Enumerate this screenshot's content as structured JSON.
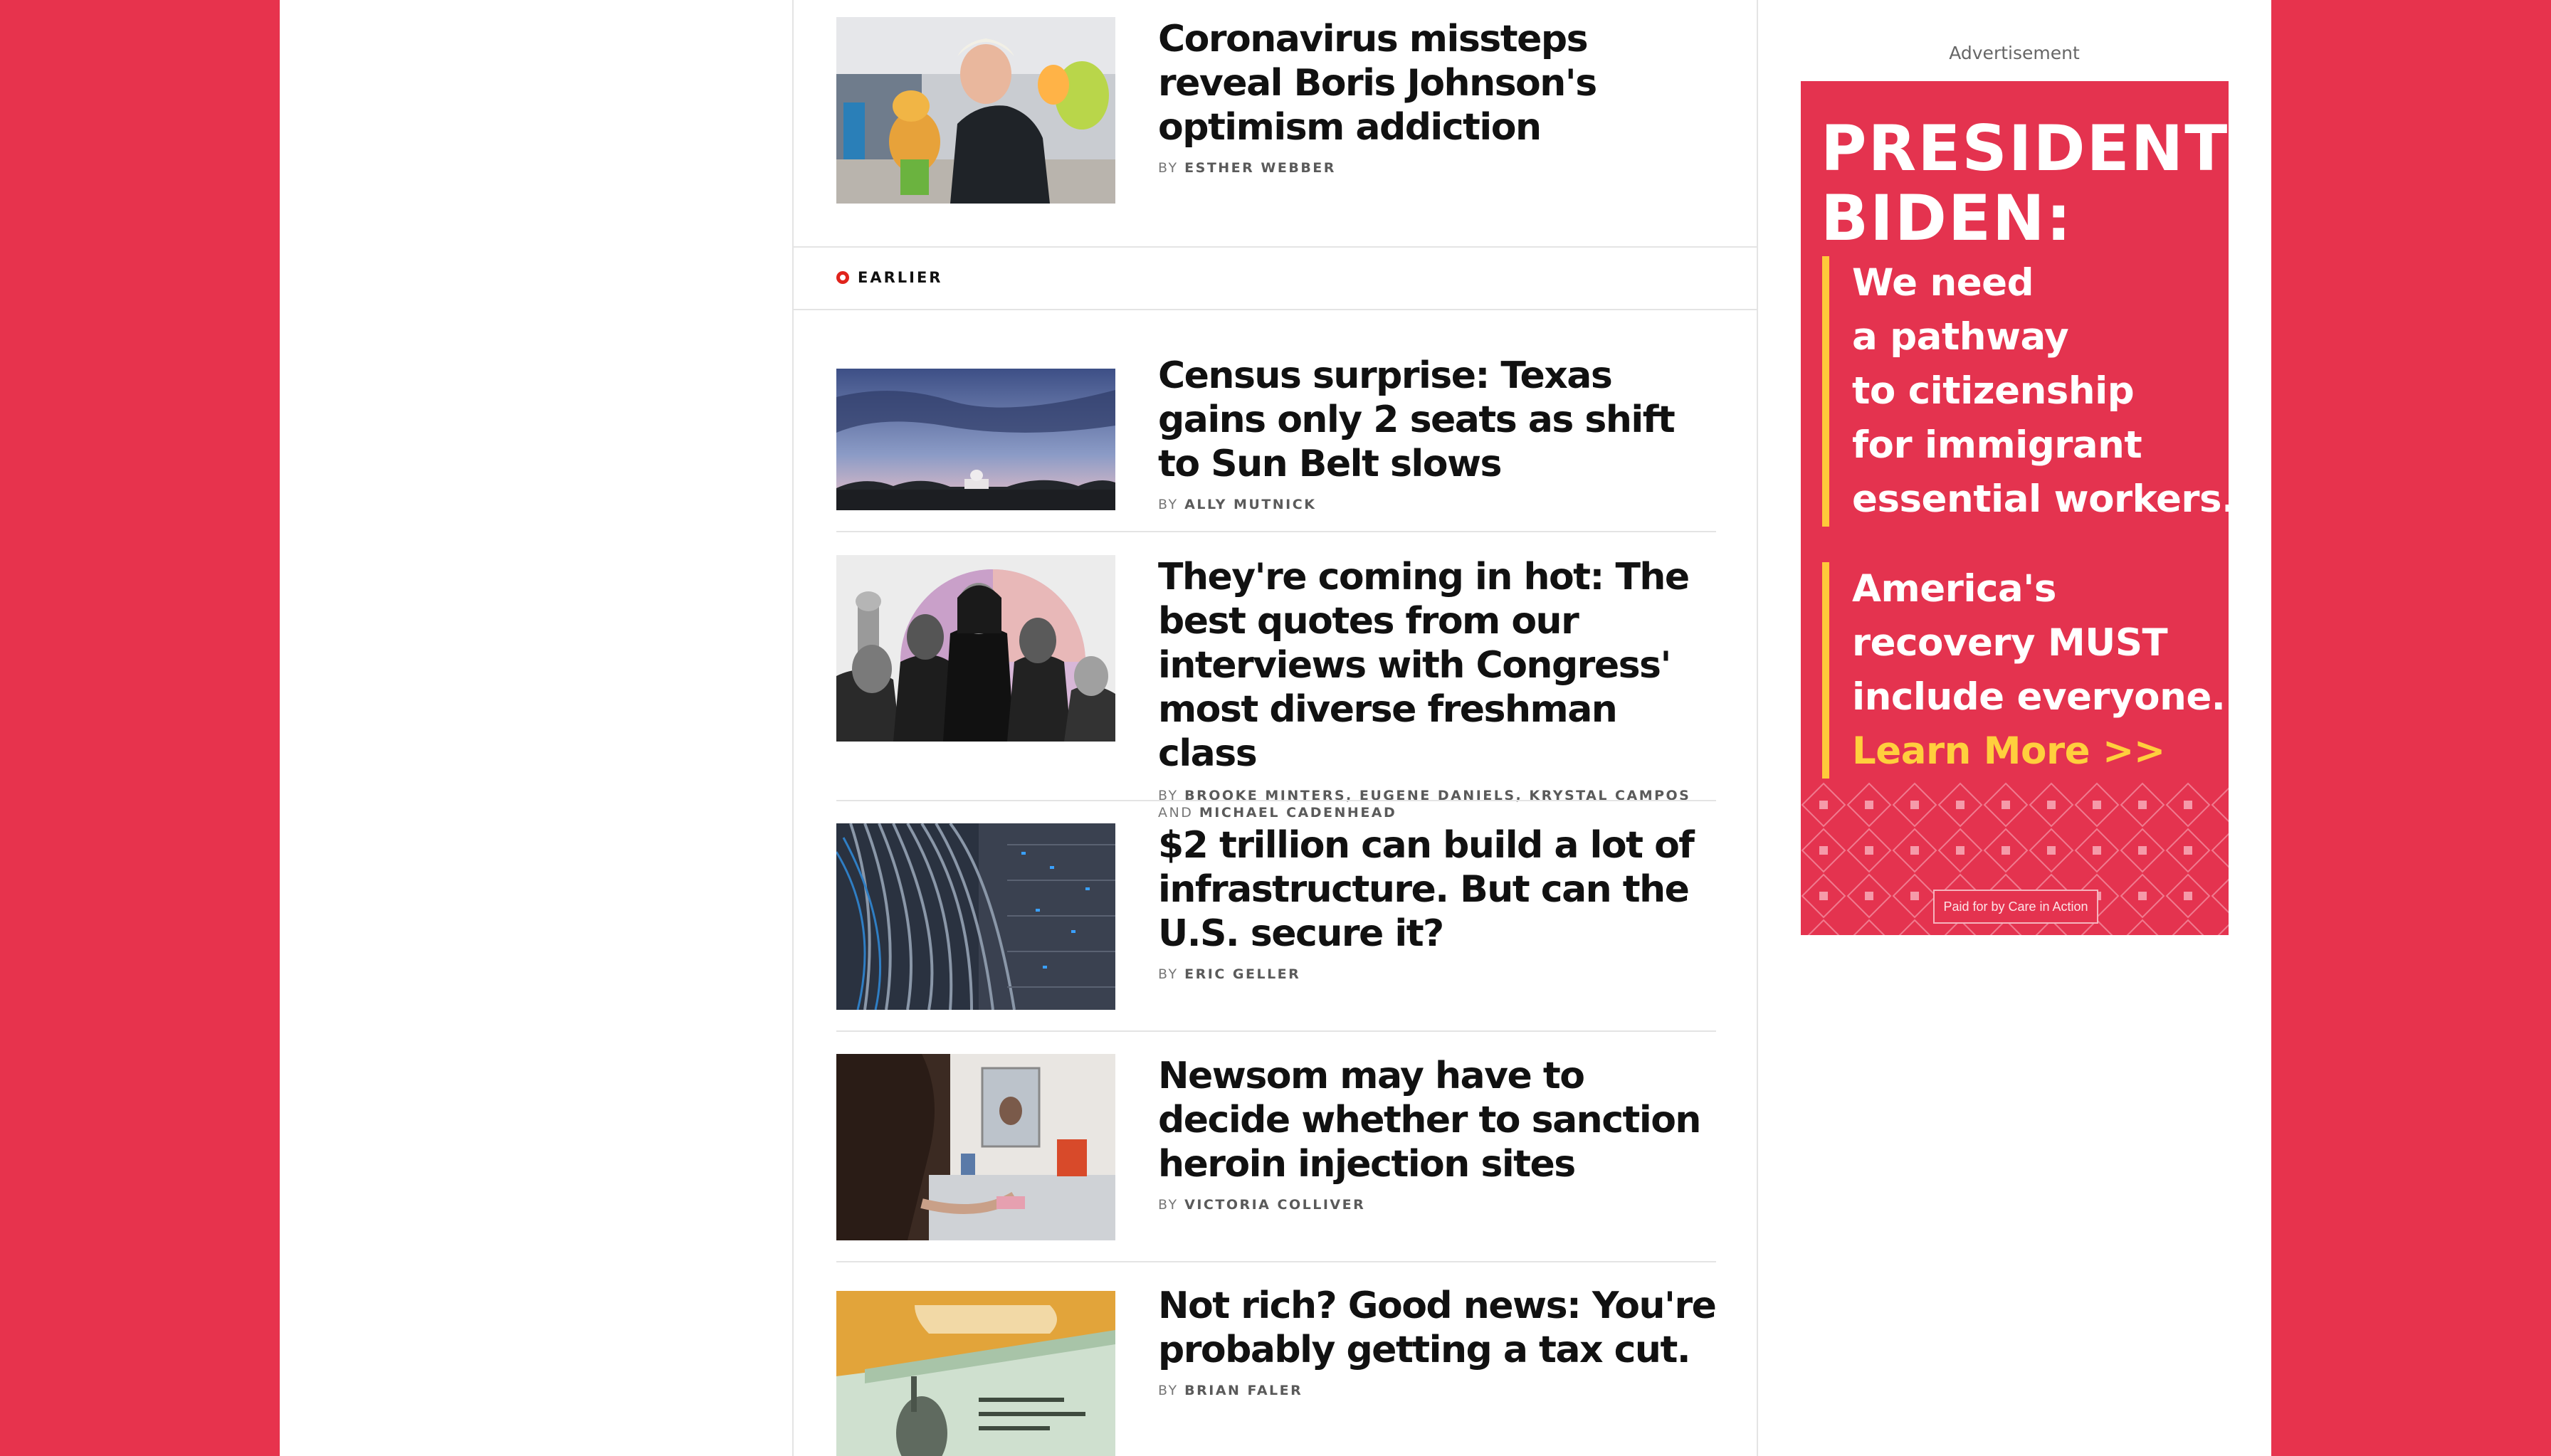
{
  "section": {
    "label": "EARLIER"
  },
  "top_story": {
    "headline": "Coronavirus missteps reveal Boris Johnson's optimism addiction",
    "by": "BY",
    "author": "ESTHER WEBBER"
  },
  "stories": [
    {
      "headline": "Census surprise: Texas gains only 2 seats as shift to Sun Belt slows",
      "by": "BY",
      "authors": "ALLY MUTNICK"
    },
    {
      "headline": "They're coming in hot: The best quotes from our interviews with Congress' most diverse freshman class",
      "by": "BY",
      "authors": "BROOKE MINTERS, EUGENE DANIELS, KRYSTAL CAMPOS",
      "and": "AND",
      "authors_2": "MICHAEL CADENHEAD"
    },
    {
      "headline": "$2 trillion can build a lot of infrastructure. But can the U.S. secure it?",
      "by": "BY",
      "authors": "ERIC GELLER"
    },
    {
      "headline": "Newsom may have to decide whether to sanction heroin injection sites",
      "by": "BY",
      "authors": "VICTORIA COLLIVER"
    },
    {
      "headline": "Not rich? Good news: You're probably getting a tax cut.",
      "by": "BY",
      "authors": "BRIAN FALER"
    }
  ],
  "ad": {
    "label": "Advertisement",
    "head_1": "PRESIDENT",
    "head_2": "BIDEN:",
    "block1": [
      "We need",
      "a pathway",
      "to citizenship",
      "for immigrant",
      "essential workers."
    ],
    "block2": [
      "America's",
      "recovery MUST",
      "include everyone."
    ],
    "cta": "Learn More >>",
    "paid": "Paid for by Care in Action"
  },
  "colors": {
    "brand_red": "#e7334d",
    "ad_yellow": "#ffc93a",
    "section_ring": "#e0231c"
  }
}
